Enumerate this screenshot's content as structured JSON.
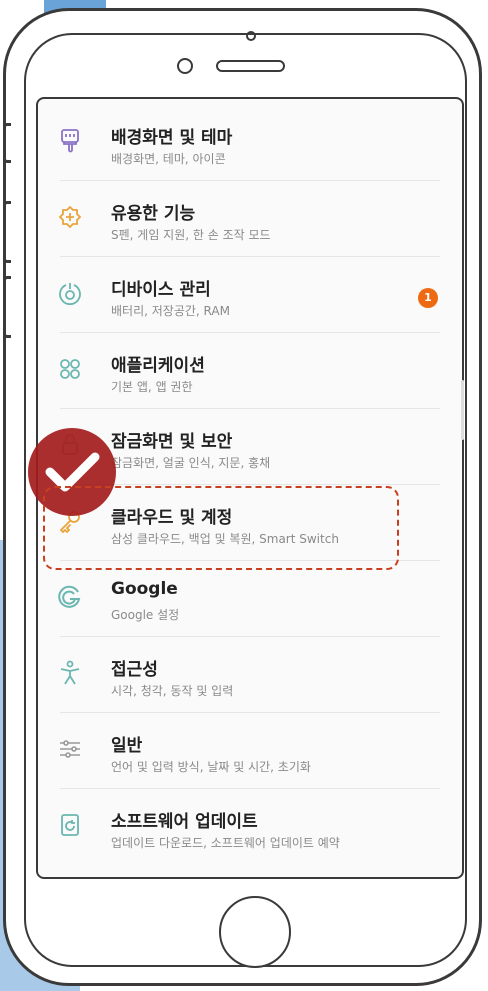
{
  "settings": {
    "items": [
      {
        "title": "배경화면 및 테마",
        "subtitle": "배경화면, 테마, 아이콘",
        "icon": "paintbrush-icon"
      },
      {
        "title": "유용한 기능",
        "subtitle": "S펜, 게임 지원, 한 손 조작 모드",
        "icon": "puzzle-icon"
      },
      {
        "title": "디바이스 관리",
        "subtitle": "배터리, 저장공간, RAM",
        "icon": "device-care-icon",
        "badge": "1"
      },
      {
        "title": "애플리케이션",
        "subtitle": "기본 앱, 앱 권한",
        "icon": "apps-grid-icon"
      },
      {
        "title": "잠금화면 및 보안",
        "subtitle": "잠금화면, 얼굴 인식, 지문, 홍채",
        "icon": "lock-icon"
      },
      {
        "title": "클라우드 및 계정",
        "subtitle": "삼성 클라우드, 백업 및 복원, Smart Switch",
        "icon": "key-icon"
      },
      {
        "title": "Google",
        "subtitle": "Google 설정",
        "icon": "google-icon"
      },
      {
        "title": "접근성",
        "subtitle": "시각, 청각, 동작 및 입력",
        "icon": "accessibility-icon"
      },
      {
        "title": "일반",
        "subtitle": "언어 및 입력 방식, 날짜 및 시간, 초기화",
        "icon": "sliders-icon"
      },
      {
        "title": "소프트웨어 업데이트",
        "subtitle": "업데이트 다운로드, 소프트웨어 업데이트 예약",
        "icon": "update-icon"
      }
    ]
  },
  "colors": {
    "icon_accent": "#6ab7b0",
    "icon_purple": "#8b73c8",
    "icon_orange": "#e9a43a",
    "badge": "#ee6a12",
    "highlight": "#c8401f",
    "check_badge": "#a41c1c",
    "bg_blue": "#a9c9e8"
  }
}
